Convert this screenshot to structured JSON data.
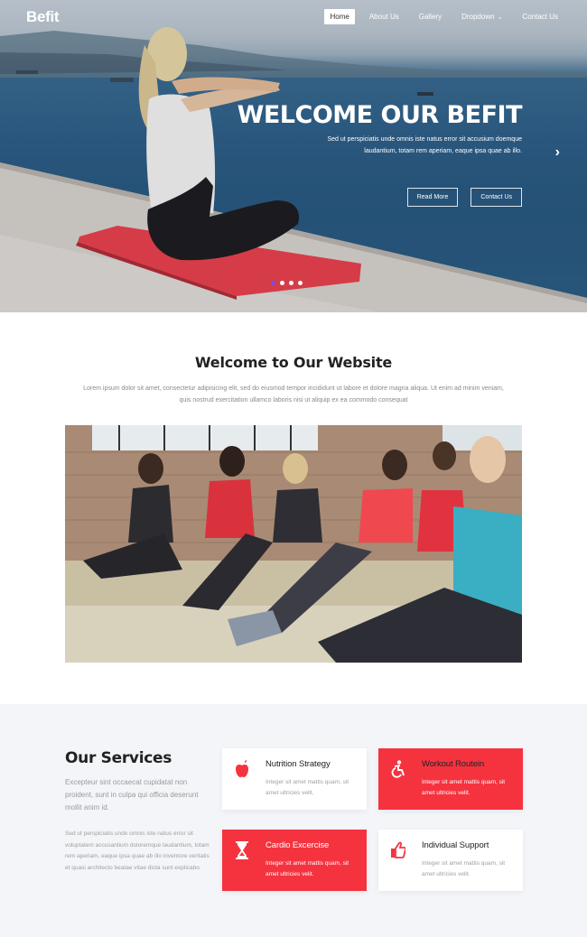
{
  "brand": "Befit",
  "nav": [
    {
      "label": "Home",
      "active": true
    },
    {
      "label": "About Us",
      "active": false
    },
    {
      "label": "Gallery",
      "active": false
    },
    {
      "label": "Dropdown",
      "active": false,
      "icon": "chevron-down-icon"
    },
    {
      "label": "Contact Us",
      "active": false
    }
  ],
  "hero": {
    "title": "WELCOME OUR BEFIT",
    "text": "Sed ut perspiciatis unde omnis iste natus error sit accusium doemque laudantium, totam rem aperiam, eaque ipsa quae ab illo.",
    "buttons": [
      "Read More",
      "Contact Us"
    ],
    "next_icon": "chevron-right-icon",
    "slides": 4,
    "active_slide": 1
  },
  "welcome": {
    "title": "Welcome to Our Website",
    "text": "Lorem ipsum dolor sit amet, consectetur adipisicing elit, sed do eiusmod tempor incididunt ut labore et dolore magna aliqua. Ut enim ad minim veniam, quis nostrud exercitation ullamco laboris nisi ut aliquip ex ea commodo consequat"
  },
  "services": {
    "title": "Our Services",
    "lead": "Excepteur sint occaecat cupidatat non proident, sunt in culpa qui officia deserunt mollit anim id.",
    "paragraph": "Sed ut perspiciatis unde omnis iste natus error sit voluptatem accusantium doloremque laudantium, totam rem aperiam, eaque ipsa quae ab illo inventore veritatis et quasi architecto beatae vitae dicta sunt explicabo.",
    "cards": [
      {
        "title": "Nutrition Strategy",
        "text": "Integer sit amet mattis quam, sit amet ultricies velit.",
        "icon": "apple-icon",
        "style": "white"
      },
      {
        "title": "Workout Routein",
        "text": "Integer sit amet mattis quam, sit amet ultricies velit.",
        "icon": "accessibility-icon",
        "style": "red"
      },
      {
        "title": "Cardio Excercise",
        "text": "Integer sit amet mattis quam, sit amet ultricies velit.",
        "icon": "hourglass-icon",
        "style": "red"
      },
      {
        "title": "Individual Support",
        "text": "Integer sit amet mattis quam, sit amet ultricies velit.",
        "icon": "thumbs-up-icon",
        "style": "white"
      }
    ]
  },
  "colors": {
    "accent": "#f5333f",
    "dot_active": "#7a4fe0",
    "sea": "#2d5c86"
  }
}
